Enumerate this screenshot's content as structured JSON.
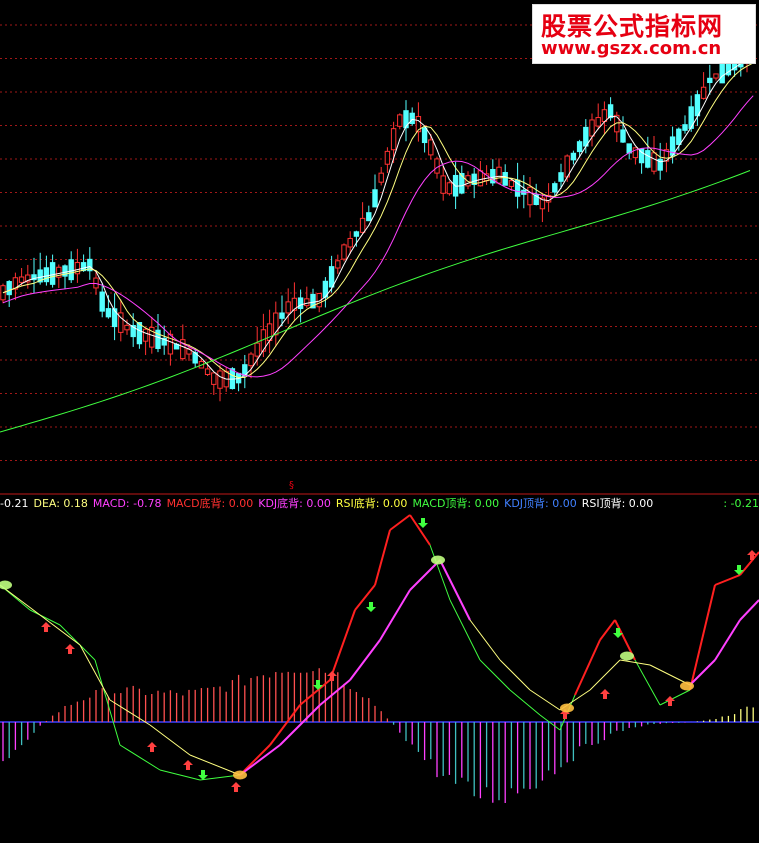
{
  "watermark": {
    "line1": "股票公式指标网",
    "line2": "www.gszx.com.cn"
  },
  "marker_text": "§",
  "indicator_bar": [
    {
      "label": "-0.21",
      "color": "#ffffff"
    },
    {
      "label": "DEA: 0.18",
      "color": "#ffff80"
    },
    {
      "label": "MACD: -0.78",
      "color": "#ff40ff"
    },
    {
      "label": "MACD底背: 0.00",
      "color": "#ff3030"
    },
    {
      "label": "KDJ底背: 0.00",
      "color": "#ff40ff"
    },
    {
      "label": "RSI底背: 0.00",
      "color": "#ffff40"
    },
    {
      "label": "MACD顶背: 0.00",
      "color": "#40ff40"
    },
    {
      "label": "KDJ顶背: 0.00",
      "color": "#4080ff"
    },
    {
      "label": "RSI顶背: 0.00",
      "color": "#ffffff"
    }
  ],
  "right_label": ": -0.21",
  "colors": {
    "background": "#000000",
    "grid": "#a01818",
    "up_candle": "#ff3232",
    "down_candle": "#54ffff",
    "ma_white": "#ffffff",
    "ma_yellow": "#ffff80",
    "ma_magenta": "#ff40ff",
    "ma_green": "#40ff40",
    "dif_red": "#ff2020",
    "dif_green": "#40ff40",
    "dea_magenta": "#ff40ff",
    "dea_yellow": "#ffff80",
    "zero_line": "#4040ff"
  },
  "chart_data": {
    "type": "line",
    "panels": [
      "candlestick price panel",
      "MACD divergence panel"
    ],
    "price_grid_lines": 14,
    "macd_zero_line": true
  }
}
